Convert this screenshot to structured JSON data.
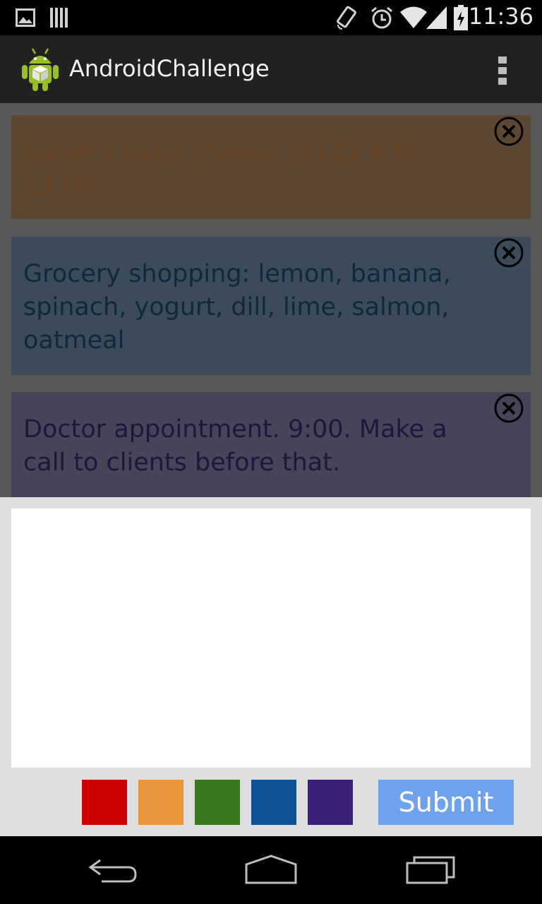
{
  "status_bar": {
    "time": "11:36",
    "icons": [
      "image-icon",
      "barcode-icon",
      "rotate-icon",
      "alarm-icon",
      "wifi-icon",
      "signal-icon",
      "battery-icon"
    ]
  },
  "action_bar": {
    "title": "AndroidChallenge",
    "logo_icon": "android-logo-icon",
    "overflow_icon": "overflow-menu-icon"
  },
  "notes": [
    {
      "text": "Sarah's baby shower @123 A St. 13:00",
      "bg": "#5c4733",
      "fg": "#6a4421"
    },
    {
      "text": "Grocery shopping: lemon, banana, spinach, yogurt, dill, lime, salmon, oatmeal",
      "bg": "#3b4b5a",
      "fg": "#12273e"
    },
    {
      "text": "Doctor appointment. 9:00.  Make a call to clients before that.",
      "bg": "#484359",
      "fg": "#1e163b"
    }
  ],
  "editor": {
    "value": "",
    "placeholder": ""
  },
  "colors": [
    {
      "name": "red",
      "hex": "#cc0000"
    },
    {
      "name": "orange",
      "hex": "#e8943a"
    },
    {
      "name": "green",
      "hex": "#38781e"
    },
    {
      "name": "blue",
      "hex": "#0f5496"
    },
    {
      "name": "purple",
      "hex": "#3b1f7a"
    }
  ],
  "submit": {
    "label": "Submit",
    "color": "#6ea2ec"
  },
  "nav_bar": {
    "icons": [
      "back-icon",
      "home-icon",
      "recents-icon"
    ]
  }
}
